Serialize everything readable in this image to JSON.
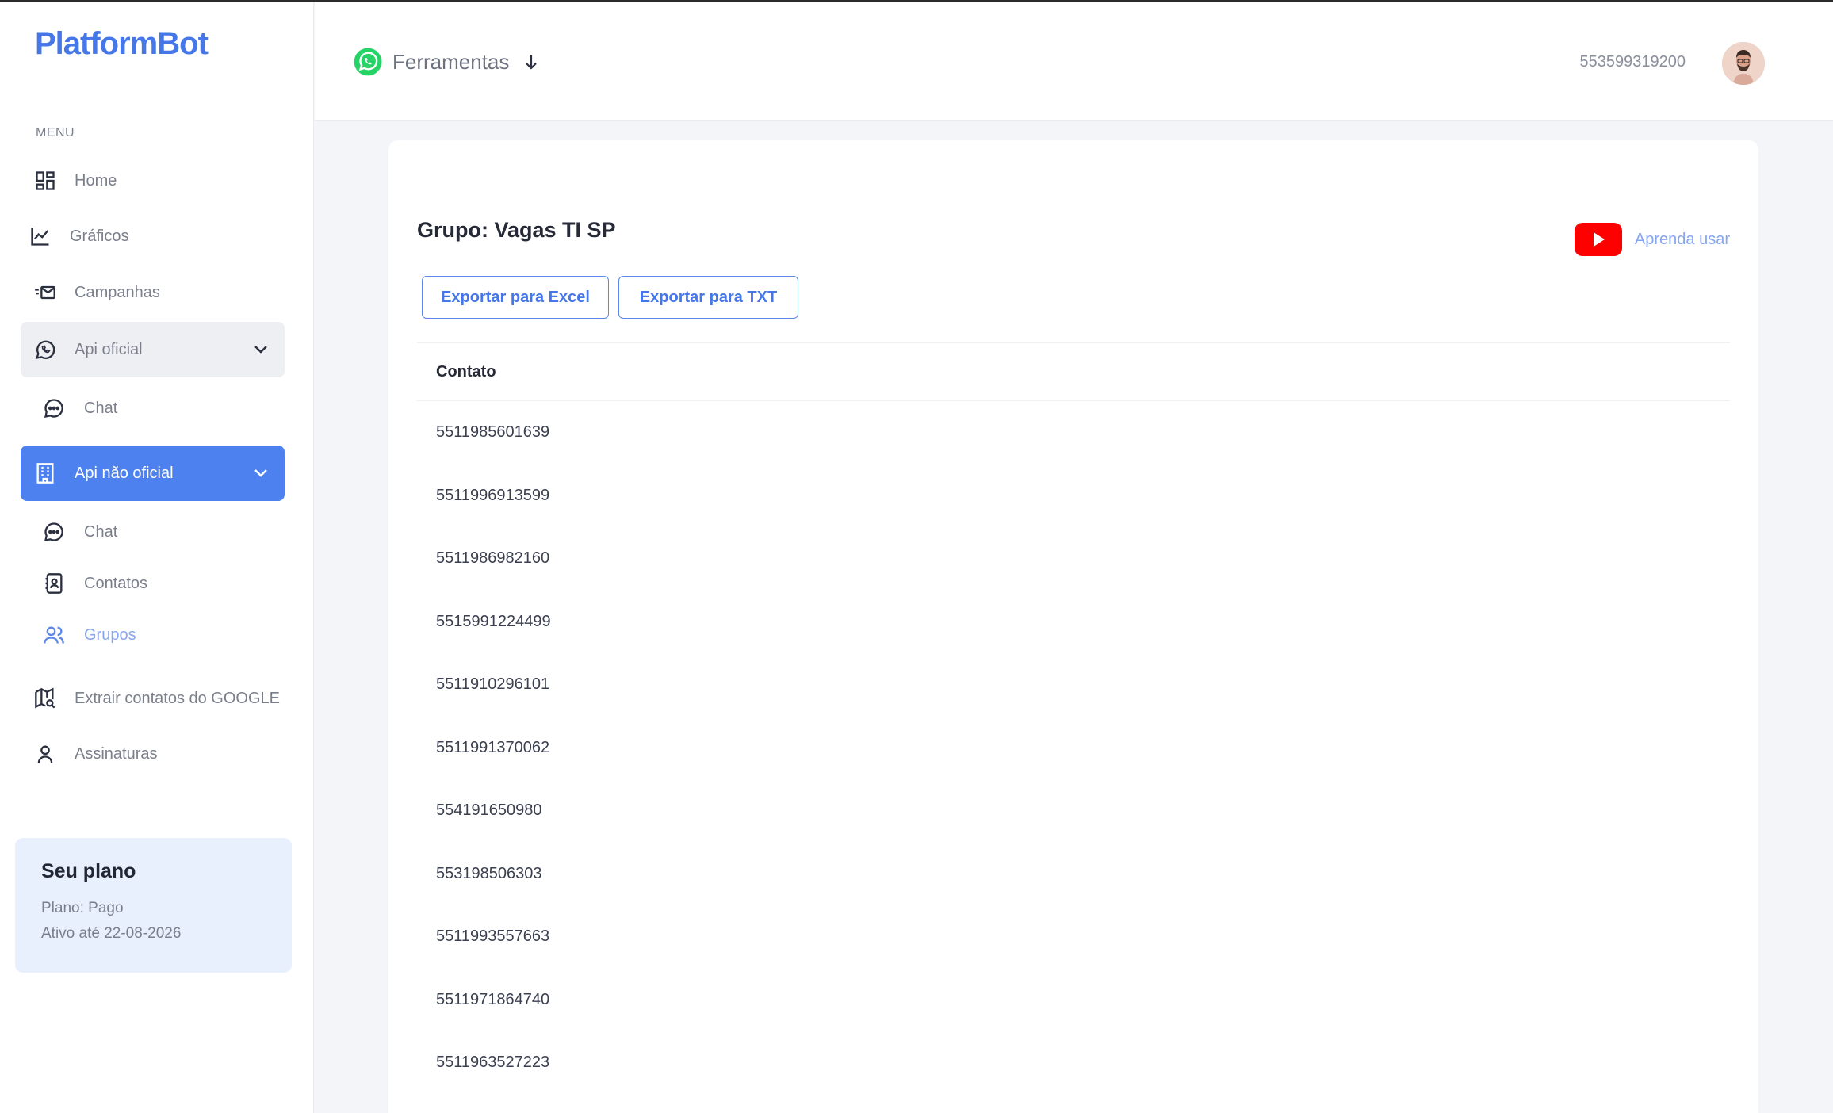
{
  "brand": {
    "logo_text": "PlatformBot"
  },
  "sidebar": {
    "menu_label": "MENU",
    "items": {
      "home": "Home",
      "graficos": "Gráficos",
      "campanhas": "Campanhas",
      "api_oficial": "Api oficial",
      "api_oficial_chat": "Chat",
      "api_nao_oficial": "Api não oficial",
      "api_nao_oficial_chat": "Chat",
      "contatos": "Contatos",
      "grupos": "Grupos",
      "extrair": "Extrair contatos do GOOGLE",
      "assinaturas": "Assinaturas"
    },
    "plan": {
      "title": "Seu plano",
      "plan_line": "Plano: Pago",
      "active_line": "Ativo até 22-08-2026"
    }
  },
  "header": {
    "tools_label": "Ferramentas",
    "phone": "553599319200"
  },
  "main": {
    "group_title": "Grupo: Vagas TI SP",
    "learn_label": "Aprenda usar",
    "export_excel": "Exportar para Excel",
    "export_txt": "Exportar para TXT",
    "table": {
      "header": "Contato",
      "rows": [
        "5511985601639",
        "5511996913599",
        "5511986982160",
        "5515991224499",
        "5511910296101",
        "5511991370062",
        "554191650980",
        "553198506303",
        "5511993557663",
        "5511971864740",
        "5511963527223"
      ]
    }
  },
  "colors": {
    "brand_blue": "#4677e8",
    "active_nav": "#4e81f0",
    "whatsapp_green": "#25d366",
    "youtube_red": "#ff0000"
  }
}
